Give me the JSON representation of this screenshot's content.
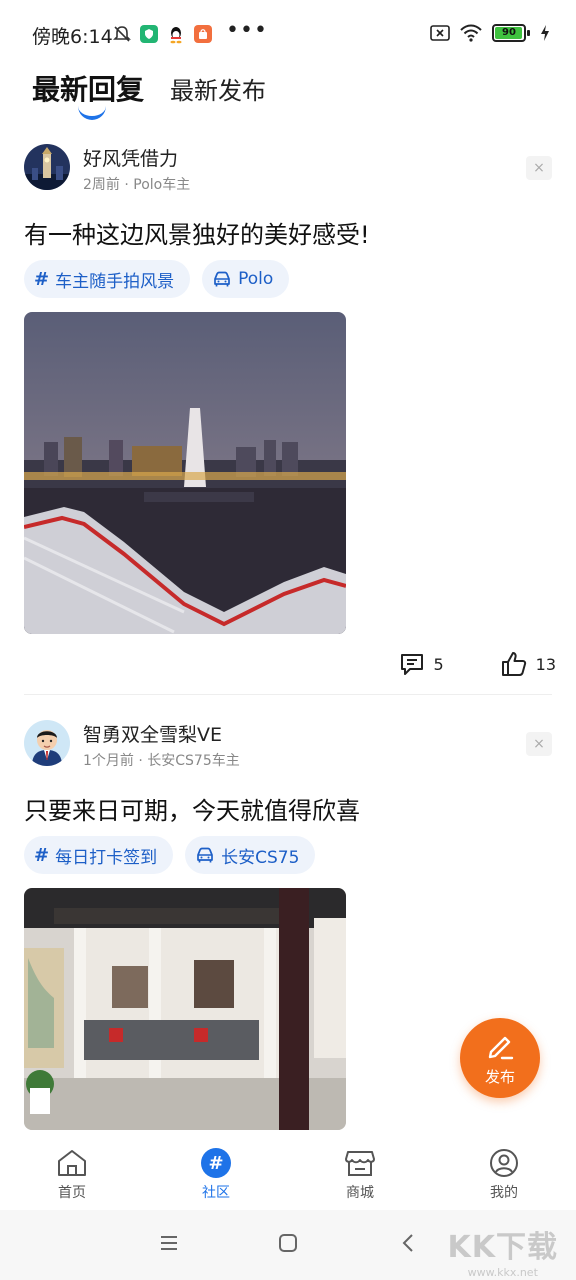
{
  "status_bar": {
    "time": "傍晚6:14",
    "battery": "90",
    "battery_level_percent": 90,
    "colors": {
      "app1": "#22b573",
      "app3": "#f26f3e"
    }
  },
  "tabs": [
    {
      "label": "最新回复",
      "active": true
    },
    {
      "label": "最新发布",
      "active": false
    }
  ],
  "posts": [
    {
      "author": "好风凭借力",
      "meta": "2周前 · Polo车主",
      "close": "×",
      "text": "有一种这边风景独好的美好感受!",
      "tags": [
        {
          "icon": "hash-icon",
          "label": "车主随手拍风景"
        },
        {
          "icon": "car-icon",
          "label": "Polo"
        }
      ],
      "comments": "5",
      "likes": "13"
    },
    {
      "author": "智勇双全雪梨VE",
      "meta": "1个月前 · 长安CS75车主",
      "close": "×",
      "text": "只要来日可期，今天就值得欣喜",
      "tags": [
        {
          "icon": "hash-icon",
          "label": "每日打卡签到"
        },
        {
          "icon": "car-icon",
          "label": "长安CS75"
        }
      ]
    }
  ],
  "fab": {
    "label": "发布",
    "color": "#f26f1c"
  },
  "bottom_nav": [
    {
      "label": "首页",
      "icon": "home-icon",
      "active": false
    },
    {
      "label": "社区",
      "icon": "hash-icon",
      "active": true
    },
    {
      "label": "商城",
      "icon": "store-icon",
      "active": false
    },
    {
      "label": "我的",
      "icon": "profile-icon",
      "active": false
    }
  ],
  "watermark": {
    "logo": "KK下载",
    "url": "www.kkx.net"
  },
  "accent_color": "#1e73e8"
}
